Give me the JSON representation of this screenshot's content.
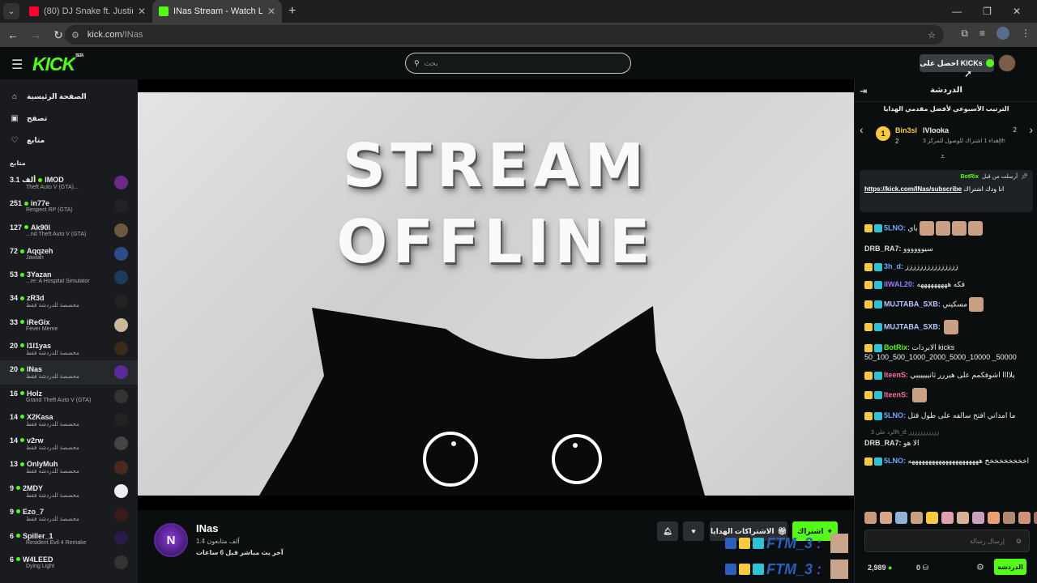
{
  "browser": {
    "tabs": [
      {
        "title": "(80) DJ Snake ft. Justin Bieber -",
        "favicon_color": "#ff0033"
      },
      {
        "title": "INas Stream - Watch Live on Ki",
        "favicon_color": "#53fc18"
      }
    ],
    "url_host": "kick.com",
    "url_path": "/INas"
  },
  "header": {
    "logo": "KICK",
    "logo_tag": "BETA",
    "search_placeholder": "بحث",
    "get_kicks": "احصل على KICKs"
  },
  "sidebar": {
    "nav": [
      {
        "label": "الصفحة الرئيسية",
        "icon": "home-icon"
      },
      {
        "label": "تصفح",
        "icon": "browse-icon"
      },
      {
        "label": "متابع",
        "icon": "heart-icon"
      }
    ],
    "section_title": "متابع",
    "channels": [
      {
        "viewers": "3.1 ألف",
        "name": "IMOD",
        "sub": "Theft Auto V (GTA)...",
        "av": "#6b2a8a"
      },
      {
        "viewers": "251",
        "name": "in77e",
        "sub": "Respect RP (GTA)",
        "av": "#222"
      },
      {
        "viewers": "127",
        "name": "Ak90l",
        "sub": "...nd Theft Auto V (GTA)",
        "av": "#6b5a3f"
      },
      {
        "viewers": "72",
        "name": "Aqqzeh",
        "sub": "Jawlah",
        "av": "#2a4c8a"
      },
      {
        "viewers": "53",
        "name": "3Yazan",
        "sub": "...re: A Hospital Simulator",
        "av": "#1e3a5a"
      },
      {
        "viewers": "34",
        "name": "zR3d",
        "sub": "مخصصة للدردشة فقط",
        "av": "#222"
      },
      {
        "viewers": "33",
        "name": "iReGix",
        "sub": "Fever Meme",
        "av": "#c9b89a"
      },
      {
        "viewers": "20",
        "name": "l1l1yas",
        "sub": "مخصصة للدردشة فقط",
        "av": "#3a2a1a"
      },
      {
        "viewers": "20",
        "name": "INas",
        "sub": "مخصصة للدردشة فقط",
        "av": "#5a2a9a"
      },
      {
        "viewers": "16",
        "name": "Holz",
        "sub": "Grand Theft Auto V (GTA)",
        "av": "#333"
      },
      {
        "viewers": "14",
        "name": "X2Kasa",
        "sub": "مخصصة للدردشة فقط",
        "av": "#222"
      },
      {
        "viewers": "14",
        "name": "v2rw",
        "sub": "مخصصة للدردشة فقط",
        "av": "#444"
      },
      {
        "viewers": "13",
        "name": "OnlyMuh",
        "sub": "مخصصة للدردشة فقط",
        "av": "#4a2a1a"
      },
      {
        "viewers": "9",
        "name": "2MDY",
        "sub": "مخصصة للدردشة فقط",
        "av": "#eee"
      },
      {
        "viewers": "9",
        "name": "Ezo_7",
        "sub": "مخصصة للدردشة فقط",
        "av": "#3a1a1a"
      },
      {
        "viewers": "6",
        "name": "Spiller_1",
        "sub": "Resident Evil 4 Remake",
        "av": "#2a1a4a"
      },
      {
        "viewers": "6",
        "name": "W4LEED",
        "sub": "Dying Light",
        "av": "#333"
      }
    ]
  },
  "player": {
    "line1": "STREAM",
    "line2": "OFFLINE"
  },
  "channel": {
    "name": "INas",
    "avatar_letter": "N",
    "followers": "1.4 ألف متابعون",
    "last_live": "آخر بث مباشر قبل 6 ساعات",
    "subscribe": "اشتراك",
    "gift": "الاشتراكات الهدايا"
  },
  "overlay": {
    "text1": "FTM_3 :",
    "text2": "FTM_3 :"
  },
  "chat": {
    "title": "الدردشة",
    "leaderboard_title": "الترتيب الأسبوعي لأفضل مقدمي الهدايا",
    "first": {
      "rank": "1",
      "name": "Bin3sl",
      "count": "2"
    },
    "second": {
      "name": "lVlooka",
      "count": "2",
      "hint": "إهداء 1 اشتراك للوصول للمركز 3th"
    },
    "pinned": {
      "by": "BotRix",
      "label": "أرسلت من قبل",
      "link": "https://kick.com/INas/subscribe",
      "text": "انا ودك اشتراك"
    },
    "messages": [
      {
        "user": "5LNO:",
        "text": "باي",
        "color": "#6ea8ff",
        "emotes": 4
      },
      {
        "user": "DRB_RA7:",
        "text": "سيوووووو",
        "color": "#ddd",
        "emotes": 0
      },
      {
        "user": "3h_d:",
        "text": "ززززززززززززززز",
        "color": "#6ea8ff",
        "emotes": 0
      },
      {
        "user": "IIWAL20:",
        "text": "فكه هههههههههه",
        "color": "#9b7bff",
        "emotes": 0
      },
      {
        "user": "MUJTABA_SXB:",
        "text": "مسكيني",
        "color": "#b9c7ff",
        "emotes": 1
      },
      {
        "user": "MUJTABA_SXB:",
        "text": "",
        "color": "#b9c7ff",
        "emotes": 1
      },
      {
        "user": "BotRix:",
        "text": "الابردات kicks 50_100_500_1000_2000_5000_10000 _50000",
        "color": "#53fc18",
        "emotes": 0
      },
      {
        "user": "IteenS:",
        "text": "يلاااا اشوفكمم على هيررر ثانييييييي",
        "color": "#ff6e9d",
        "emotes": 0
      },
      {
        "user": "IteenS:",
        "text": "",
        "color": "#ff6e9d",
        "emotes": 1
      },
      {
        "user": "5LNO:",
        "text": "ما امداني افتح سالفه على طول قتل",
        "color": "#6ea8ff",
        "emotes": 0
      },
      {
        "user": "DRB_RA7:",
        "text": "الا هو",
        "color": "#ddd",
        "emotes": 0,
        "reply": "الرد على 3h_d: ززززززززززز"
      },
      {
        "user": "5LNO:",
        "text": "اخخخخخخخخخ هههههههههههههههههههههه",
        "color": "#6ea8ff",
        "emotes": 0
      }
    ],
    "input_placeholder": "إرسال رسالة",
    "kicks_balance": "0",
    "points": "2,989",
    "chat_button": "الدردشة"
  }
}
